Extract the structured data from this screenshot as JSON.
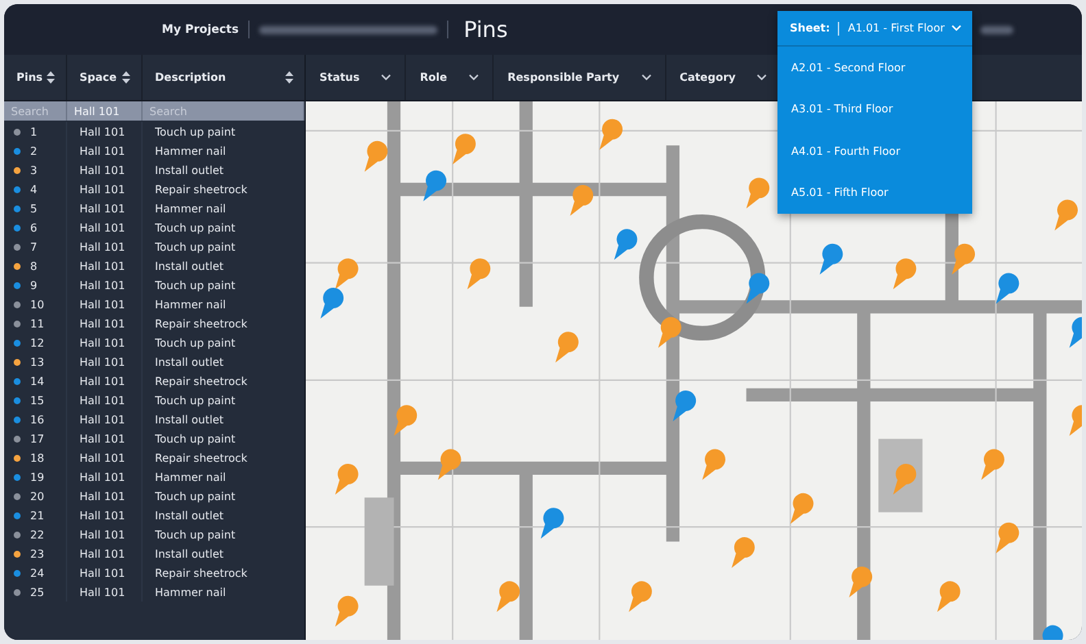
{
  "top_bar": {
    "breadcrumb": "My Projects",
    "title": "Pins"
  },
  "sheet_menu": {
    "label": "Sheet:",
    "current": "A1.01 - First Floor",
    "expanded": true,
    "options": [
      {
        "label": "A2.01 - Second Floor"
      },
      {
        "label": "A3.01 - Third Floor"
      },
      {
        "label": "A4.01 - Fourth Floor"
      },
      {
        "label": "A5.01 - Fifth Floor"
      }
    ]
  },
  "table": {
    "columns": [
      {
        "label": "Pins",
        "sortable": true
      },
      {
        "label": "Space",
        "sortable": true
      },
      {
        "label": "Description",
        "sortable": true
      }
    ],
    "filters": [
      {
        "placeholder": "Search"
      },
      {
        "value": "Hall 101"
      },
      {
        "placeholder": "Search"
      }
    ],
    "rows": [
      {
        "pin": "1",
        "space": "Hall 101",
        "description": "Touch up paint",
        "color": "#8a909b"
      },
      {
        "pin": "2",
        "space": "Hall 101",
        "description": "Hammer nail",
        "color": "#1a8ee0"
      },
      {
        "pin": "3",
        "space": "Hall 101",
        "description": "Install outlet",
        "color": "#f5a340"
      },
      {
        "pin": "4",
        "space": "Hall 101",
        "description": "Repair sheetrock",
        "color": "#1a8ee0"
      },
      {
        "pin": "5",
        "space": "Hall 101",
        "description": "Hammer nail",
        "color": "#1a8ee0"
      },
      {
        "pin": "6",
        "space": "Hall 101",
        "description": "Touch up paint",
        "color": "#1a8ee0"
      },
      {
        "pin": "7",
        "space": "Hall 101",
        "description": "Touch up paint",
        "color": "#8a909b"
      },
      {
        "pin": "8",
        "space": "Hall 101",
        "description": "Install outlet",
        "color": "#f5a340"
      },
      {
        "pin": "9",
        "space": "Hall 101",
        "description": "Touch up paint",
        "color": "#1a8ee0"
      },
      {
        "pin": "10",
        "space": "Hall 101",
        "description": "Hammer nail",
        "color": "#8a909b"
      },
      {
        "pin": "11",
        "space": "Hall 101",
        "description": "Repair sheetrock",
        "color": "#8a909b"
      },
      {
        "pin": "12",
        "space": "Hall 101",
        "description": "Touch up paint",
        "color": "#1a8ee0"
      },
      {
        "pin": "13",
        "space": "Hall 101",
        "description": "Install outlet",
        "color": "#f5a340"
      },
      {
        "pin": "14",
        "space": "Hall 101",
        "description": "Repair sheetrock",
        "color": "#1a8ee0"
      },
      {
        "pin": "15",
        "space": "Hall 101",
        "description": "Touch up paint",
        "color": "#1a8ee0"
      },
      {
        "pin": "16",
        "space": "Hall 101",
        "description": "Install outlet",
        "color": "#1a8ee0"
      },
      {
        "pin": "17",
        "space": "Hall 101",
        "description": "Touch up paint",
        "color": "#8a909b"
      },
      {
        "pin": "18",
        "space": "Hall 101",
        "description": "Repair sheetrock",
        "color": "#f5a340"
      },
      {
        "pin": "19",
        "space": "Hall 101",
        "description": "Hammer nail",
        "color": "#1a8ee0"
      },
      {
        "pin": "20",
        "space": "Hall 101",
        "description": "Touch up paint",
        "color": "#8a909b"
      },
      {
        "pin": "21",
        "space": "Hall 101",
        "description": "Install outlet",
        "color": "#1a8ee0"
      },
      {
        "pin": "22",
        "space": "Hall 101",
        "description": "Touch up paint",
        "color": "#8a909b"
      },
      {
        "pin": "23",
        "space": "Hall 101",
        "description": "Install outlet",
        "color": "#f5a340"
      },
      {
        "pin": "24",
        "space": "Hall 101",
        "description": "Repair sheetrock",
        "color": "#1a8ee0"
      },
      {
        "pin": "25",
        "space": "Hall 101",
        "description": "Hammer nail",
        "color": "#8a909b"
      }
    ]
  },
  "filter_bar": [
    {
      "label": "Status"
    },
    {
      "label": "Role"
    },
    {
      "label": "Responsible Party"
    },
    {
      "label": "Category"
    }
  ]
}
